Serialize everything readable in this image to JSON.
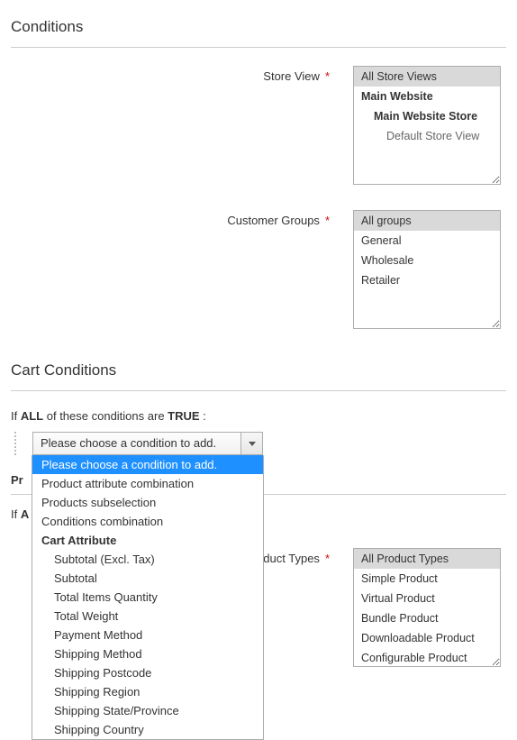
{
  "sections": {
    "conditions_title": "Conditions",
    "cart_conditions_title": "Cart Conditions"
  },
  "labels": {
    "store_view": "Store View",
    "customer_groups": "Customer Groups",
    "product_types": "Product Types"
  },
  "store_view": {
    "items": [
      {
        "label": "All Store Views",
        "selected": true
      },
      {
        "label": "Main Website",
        "bold": true
      },
      {
        "label": "Main Website Store",
        "bold": true,
        "indent": 1
      },
      {
        "label": "Default Store View",
        "indent": 2
      }
    ]
  },
  "customer_groups": {
    "items": [
      {
        "label": "All groups",
        "selected": true
      },
      {
        "label": "General"
      },
      {
        "label": "Wholesale"
      },
      {
        "label": "Retailer"
      }
    ]
  },
  "product_types": {
    "items": [
      {
        "label": "All Product Types",
        "selected": true
      },
      {
        "label": "Simple Product"
      },
      {
        "label": "Virtual Product"
      },
      {
        "label": "Bundle Product"
      },
      {
        "label": "Downloadable Product"
      },
      {
        "label": "Configurable Product"
      }
    ]
  },
  "cond_sentence": {
    "prefix": "If ",
    "all": "ALL",
    "mid": "  of these conditions are ",
    "true": "TRUE",
    "suffix": " :"
  },
  "behind": {
    "pr_label": "Pr",
    "if_prefix": "If ",
    "a": "A"
  },
  "select": {
    "value": "Please choose a condition to add.",
    "options": [
      {
        "label": "Please choose a condition to add.",
        "hl": true
      },
      {
        "label": "Product attribute combination"
      },
      {
        "label": "Products subselection"
      },
      {
        "label": "Conditions combination"
      },
      {
        "label": "Cart Attribute",
        "group": true
      },
      {
        "label": "Subtotal (Excl. Tax)",
        "child": true
      },
      {
        "label": "Subtotal",
        "child": true
      },
      {
        "label": "Total Items Quantity",
        "child": true
      },
      {
        "label": "Total Weight",
        "child": true
      },
      {
        "label": "Payment Method",
        "child": true
      },
      {
        "label": "Shipping Method",
        "child": true
      },
      {
        "label": "Shipping Postcode",
        "child": true
      },
      {
        "label": "Shipping Region",
        "child": true
      },
      {
        "label": "Shipping State/Province",
        "child": true
      },
      {
        "label": "Shipping Country",
        "child": true
      }
    ]
  }
}
